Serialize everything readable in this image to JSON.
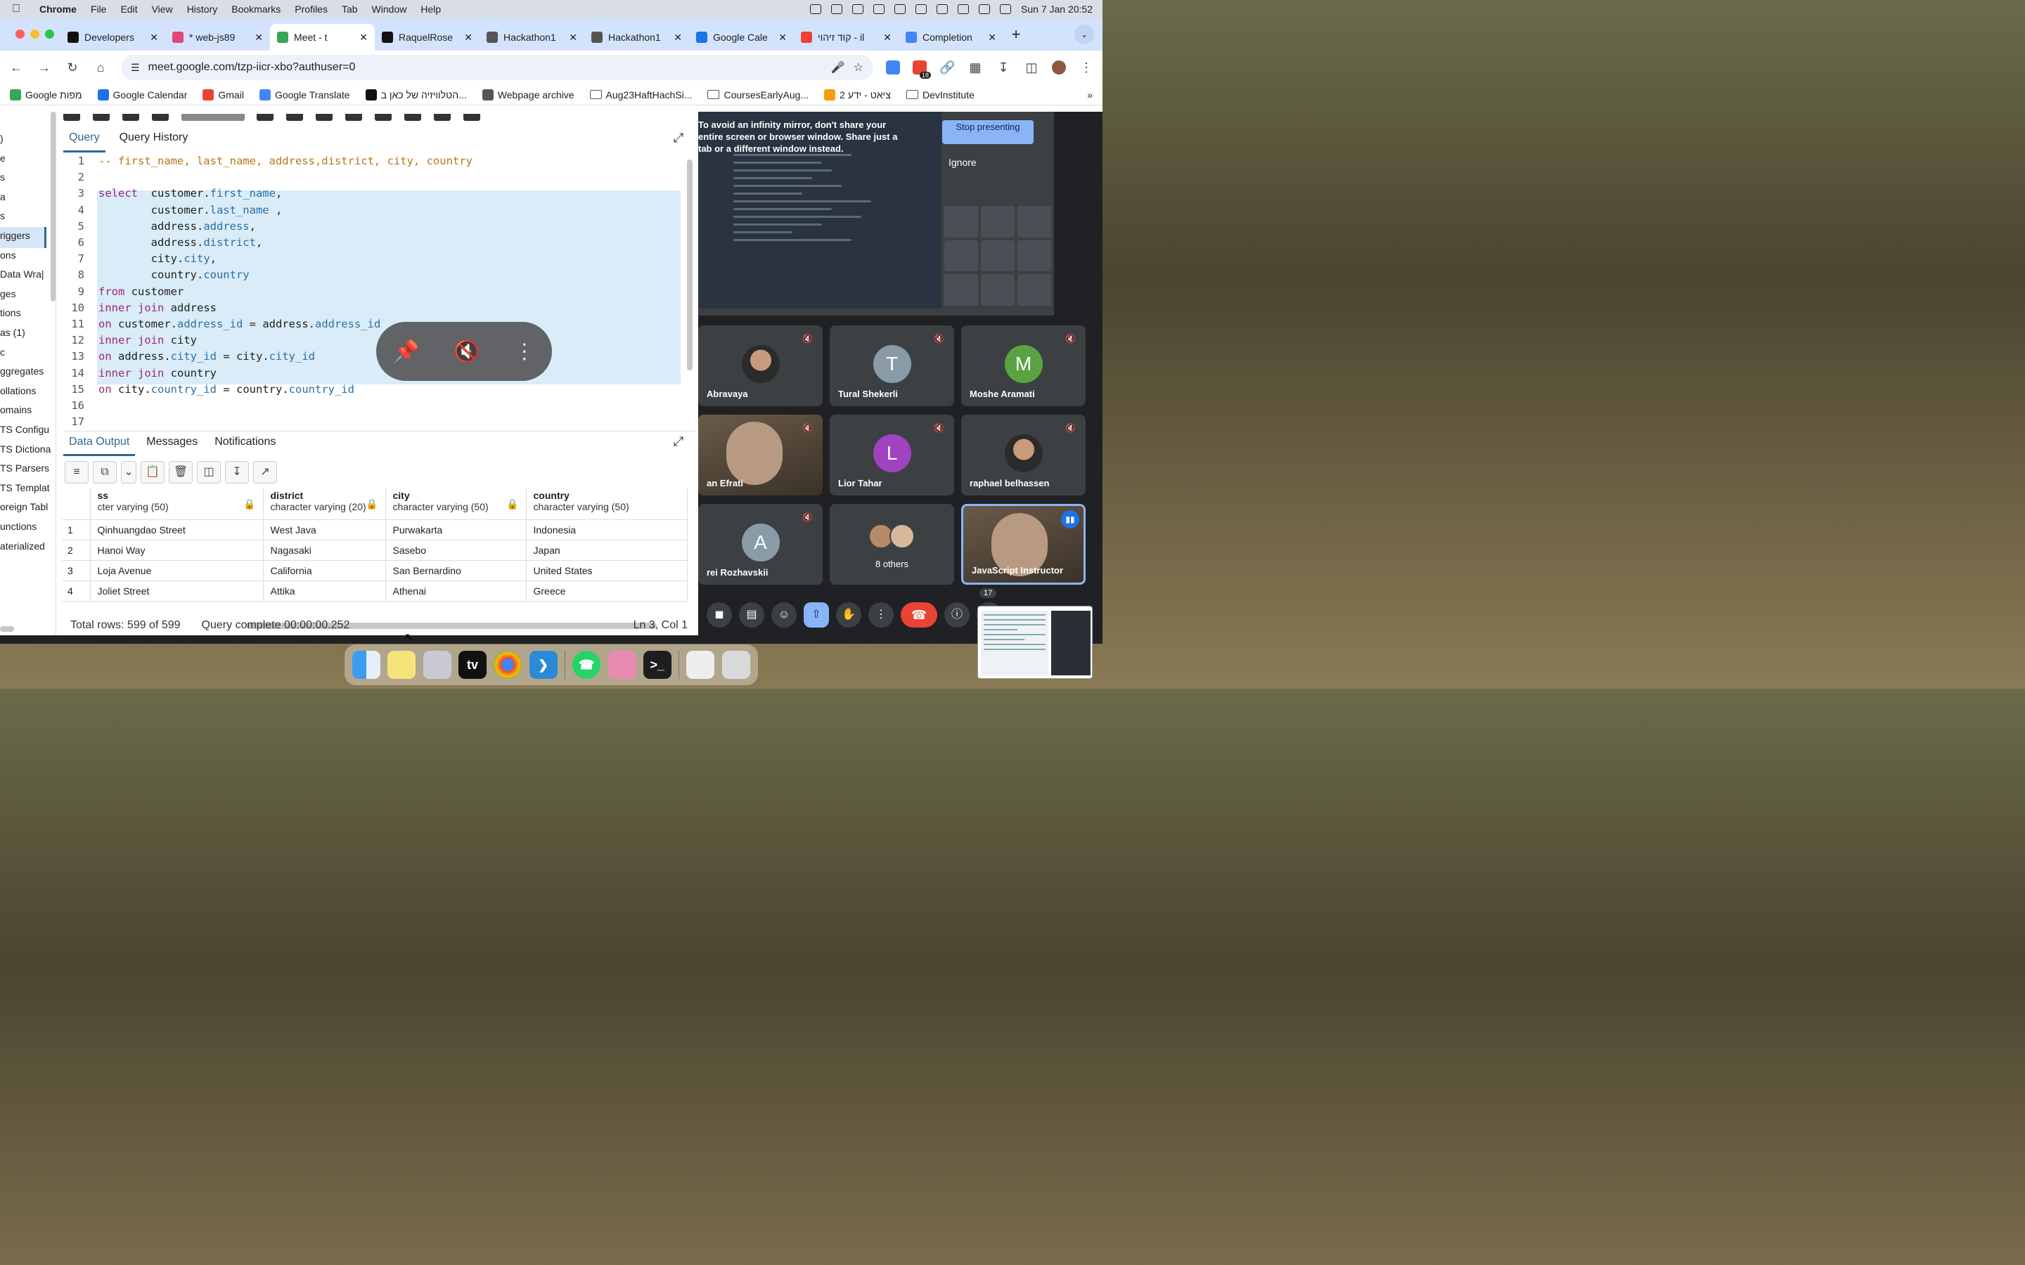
{
  "menubar": {
    "app": "Chrome",
    "items": [
      "File",
      "Edit",
      "View",
      "History",
      "Bookmarks",
      "Profiles",
      "Tab",
      "Window",
      "Help"
    ],
    "clock": "Sun 7 Jan  20:52"
  },
  "tabs": [
    {
      "title": "Developers",
      "color": "#111111"
    },
    {
      "title": "* web-js89",
      "color": "#e0457b"
    },
    {
      "title": "Meet - t",
      "color": "#34a853",
      "active": true
    },
    {
      "title": "RaquelRose",
      "color": "#111111"
    },
    {
      "title": "Hackathon1",
      "color": "#555555"
    },
    {
      "title": "Hackathon1",
      "color": "#555555"
    },
    {
      "title": "Google Cale",
      "color": "#1a73e8"
    },
    {
      "title": "קוד זיהוי - il",
      "color": "#ea4335"
    },
    {
      "title": "Completion",
      "color": "#4285f4"
    }
  ],
  "address": {
    "url": "meet.google.com/tzp-iicr-xbo?authuser=0",
    "extension_badge": "18"
  },
  "bookmarks": [
    {
      "label": "Google מפות",
      "type": "site",
      "color": "#34a853"
    },
    {
      "label": "Google Calendar",
      "type": "site",
      "color": "#1a73e8"
    },
    {
      "label": "Gmail",
      "type": "site",
      "color": "#ea4335"
    },
    {
      "label": "Google Translate",
      "type": "site",
      "color": "#4285f4"
    },
    {
      "label": "הטלוויזיה של כאן ב...",
      "type": "site",
      "color": "#111111"
    },
    {
      "label": "Webpage archive",
      "type": "site",
      "color": "#555555"
    },
    {
      "label": "Aug23HaftHachSi...",
      "type": "folder"
    },
    {
      "label": "CoursesEarlyAug...",
      "type": "folder"
    },
    {
      "label": "ציאט - ידע 2",
      "type": "site",
      "color": "#f59e0b"
    },
    {
      "label": "DevInstitute",
      "type": "folder"
    }
  ],
  "pgadmin": {
    "browser_items": [
      ")",
      "e",
      "s",
      "a",
      "s",
      "riggers",
      "ons",
      " Data Wra|",
      "ges",
      "tions",
      "as (1)",
      "c",
      "ggregates",
      "ollations",
      "omains",
      "TS Configu",
      "TS Dictiona",
      "TS Parsers",
      "TS Templat",
      "oreign Tabl",
      "unctions",
      "aterialized"
    ],
    "query_tabs": [
      "Query",
      "Query History"
    ],
    "editor_lines": [
      {
        "n": "1",
        "parts": [
          {
            "t": "-- first_name, last_name, address,district, city, country",
            "c": "cm"
          }
        ]
      },
      {
        "n": "2",
        "parts": []
      },
      {
        "n": "3",
        "parts": [
          {
            "t": "select",
            "c": "kw"
          },
          {
            "t": "  customer.",
            "c": ""
          },
          {
            "t": "first_name",
            "c": "prop"
          },
          {
            "t": ",",
            "c": ""
          }
        ]
      },
      {
        "n": "4",
        "parts": [
          {
            "t": "        customer.",
            "c": ""
          },
          {
            "t": "last_name",
            "c": "prop"
          },
          {
            "t": " ,",
            "c": ""
          }
        ]
      },
      {
        "n": "5",
        "parts": [
          {
            "t": "        address.",
            "c": ""
          },
          {
            "t": "address",
            "c": "prop"
          },
          {
            "t": ",",
            "c": ""
          }
        ]
      },
      {
        "n": "6",
        "parts": [
          {
            "t": "        address.",
            "c": ""
          },
          {
            "t": "district",
            "c": "prop"
          },
          {
            "t": ",",
            "c": ""
          }
        ]
      },
      {
        "n": "7",
        "parts": [
          {
            "t": "        city.",
            "c": ""
          },
          {
            "t": "city",
            "c": "prop"
          },
          {
            "t": ",",
            "c": ""
          }
        ]
      },
      {
        "n": "8",
        "parts": [
          {
            "t": "        country.",
            "c": ""
          },
          {
            "t": "country",
            "c": "prop"
          }
        ]
      },
      {
        "n": "9",
        "parts": [
          {
            "t": "from",
            "c": "kw"
          },
          {
            "t": " customer",
            "c": ""
          }
        ]
      },
      {
        "n": "10",
        "parts": [
          {
            "t": "inner join",
            "c": "kw"
          },
          {
            "t": " address",
            "c": ""
          }
        ]
      },
      {
        "n": "11",
        "parts": [
          {
            "t": "on",
            "c": "kw"
          },
          {
            "t": " customer.",
            "c": ""
          },
          {
            "t": "address_id",
            "c": "prop"
          },
          {
            "t": " = address.",
            "c": ""
          },
          {
            "t": "address_id",
            "c": "prop"
          }
        ]
      },
      {
        "n": "12",
        "parts": [
          {
            "t": "inner join",
            "c": "kw"
          },
          {
            "t": " city",
            "c": ""
          }
        ]
      },
      {
        "n": "13",
        "parts": [
          {
            "t": "on",
            "c": "kw"
          },
          {
            "t": " address.",
            "c": ""
          },
          {
            "t": "city_id",
            "c": "prop"
          },
          {
            "t": " = city.",
            "c": ""
          },
          {
            "t": "city_id",
            "c": "prop"
          }
        ]
      },
      {
        "n": "14",
        "parts": [
          {
            "t": "inner join",
            "c": "kw"
          },
          {
            "t": " country",
            "c": ""
          }
        ]
      },
      {
        "n": "15",
        "parts": [
          {
            "t": "on",
            "c": "kw"
          },
          {
            "t": " city.",
            "c": ""
          },
          {
            "t": "country_id",
            "c": "prop"
          },
          {
            "t": " = country.",
            "c": ""
          },
          {
            "t": "country_id",
            "c": "prop"
          }
        ]
      },
      {
        "n": "16",
        "parts": []
      },
      {
        "n": "17",
        "parts": []
      }
    ],
    "output_tabs": [
      "Data Output",
      "Messages",
      "Notifications"
    ],
    "columns": [
      {
        "name": "ss",
        "type": "cter varying (50)"
      },
      {
        "name": "district",
        "type": "character varying (20)"
      },
      {
        "name": "city",
        "type": "character varying (50)"
      },
      {
        "name": "country",
        "type": "character varying (50)"
      }
    ],
    "rows": [
      {
        "n": "1",
        "address": "Qinhuangdao Street",
        "district": "West Java",
        "city": "Purwakarta",
        "country": "Indonesia"
      },
      {
        "n": "2",
        "address": "Hanoi Way",
        "district": "Nagasaki",
        "city": "Sasebo",
        "country": "Japan"
      },
      {
        "n": "3",
        "address": "Loja Avenue",
        "district": "California",
        "city": "San Bernardino",
        "country": "United States"
      },
      {
        "n": "4",
        "address": "Joliet Street",
        "district": "Attika",
        "city": "Athenai",
        "country": "Greece"
      }
    ],
    "status": {
      "total_rows": "Total rows: 599 of 599",
      "query_time": "Query complete 00:00:00.252",
      "cursor": "Ln 3, Col 1"
    }
  },
  "meet": {
    "mirror_warning": "To avoid an infinity mirror, don't share your entire screen or browser window. Share just a tab or a different window instead.",
    "stop_presenting": "Stop presenting",
    "ignore": "Ignore",
    "participants": [
      {
        "name": "Abravaya",
        "kind": "photo"
      },
      {
        "name": "Tural Shekerli",
        "kind": "letter",
        "letter": "T",
        "color": "#8a9ba8"
      },
      {
        "name": "Moshe Aramati",
        "kind": "letter",
        "letter": "M",
        "color": "#5aa342"
      },
      {
        "name": "an Efrati",
        "kind": "camera"
      },
      {
        "name": "Lior Tahar",
        "kind": "letter",
        "letter": "L",
        "color": "#a142c1"
      },
      {
        "name": "raphael belhassen",
        "kind": "photo"
      },
      {
        "name": "rei Rozhavskii",
        "kind": "letter",
        "letter": "A",
        "color": "#8a9ba8"
      },
      {
        "name": "8 others",
        "kind": "group"
      },
      {
        "name": "JavaScript Instructor",
        "kind": "camera",
        "speaking": true
      }
    ],
    "participant_count": "17"
  }
}
